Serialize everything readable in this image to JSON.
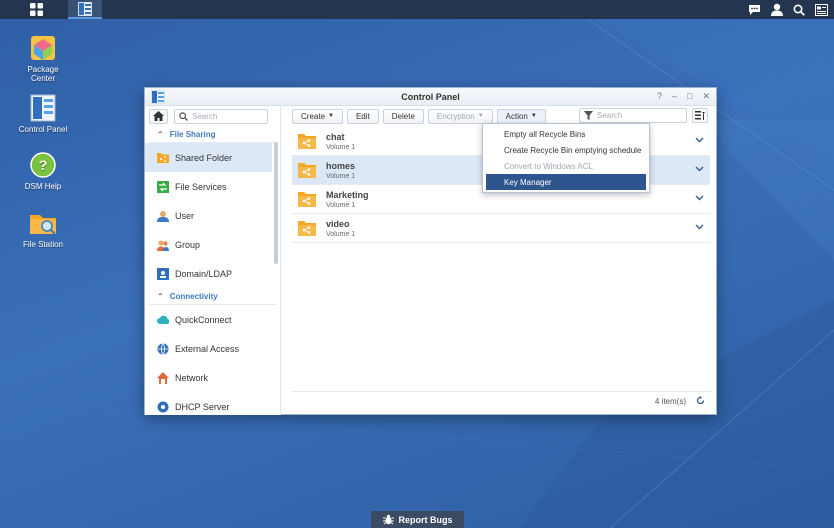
{
  "desktop": {
    "icons": [
      {
        "label_line1": "Package",
        "label_line2": "Center",
        "icon": "package-center-icon"
      },
      {
        "label_line1": "Control Panel",
        "label_line2": "",
        "icon": "control-panel-icon"
      },
      {
        "label_line1": "DSM Help",
        "label_line2": "",
        "icon": "help-icon"
      },
      {
        "label_line1": "File Station",
        "label_line2": "",
        "icon": "file-station-icon"
      }
    ],
    "report_bugs": "Report Bugs"
  },
  "window": {
    "title": "Control Panel",
    "controls": {
      "help": "?",
      "minimize": "–",
      "maximize": "□",
      "close": "✕"
    }
  },
  "sidebar": {
    "search_placeholder": "Search",
    "sections": [
      {
        "title": "File Sharing",
        "items": [
          {
            "label": "Shared Folder",
            "icon": "shared-folder-icon",
            "selected": true
          },
          {
            "label": "File Services",
            "icon": "file-services-icon"
          },
          {
            "label": "User",
            "icon": "user-icon"
          },
          {
            "label": "Group",
            "icon": "group-icon"
          },
          {
            "label": "Domain/LDAP",
            "icon": "domain-ldap-icon"
          }
        ]
      },
      {
        "title": "Connectivity",
        "items": [
          {
            "label": "QuickConnect",
            "icon": "quickconnect-icon"
          },
          {
            "label": "External Access",
            "icon": "external-access-icon"
          },
          {
            "label": "Network",
            "icon": "network-icon"
          },
          {
            "label": "DHCP Server",
            "icon": "dhcp-server-icon"
          }
        ]
      }
    ]
  },
  "toolbar": {
    "create": "Create",
    "edit": "Edit",
    "delete": "Delete",
    "encryption": "Encryption",
    "action": "Action",
    "search_placeholder": "Search"
  },
  "folders": [
    {
      "name": "chat",
      "volume": "Volume 1",
      "selected": false
    },
    {
      "name": "homes",
      "volume": "Volume 1",
      "selected": true
    },
    {
      "name": "Marketing",
      "volume": "Volume 1",
      "selected": false
    },
    {
      "name": "video",
      "volume": "Volume 1",
      "selected": false
    }
  ],
  "footer": {
    "count": "4 item(s)"
  },
  "action_menu": {
    "items": [
      {
        "label": "Empty all Recycle Bins",
        "state": "normal"
      },
      {
        "label": "Create Recycle Bin emptying schedule",
        "state": "normal"
      },
      {
        "label": "Convert to Windows ACL",
        "state": "disabled"
      },
      {
        "label": "Key Manager",
        "state": "active"
      }
    ]
  },
  "colors": {
    "desktop": "#3568ad",
    "taskbar": "#24364f",
    "selection": "#dce8f6",
    "menu_active": "#2d568f",
    "accent": "#3d79bf",
    "folder": "#f5a623"
  }
}
